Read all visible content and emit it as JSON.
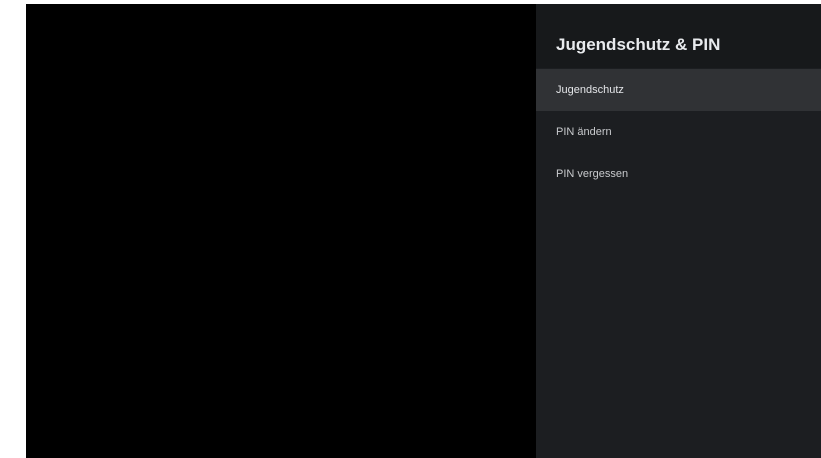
{
  "panel": {
    "title": "Jugendschutz & PIN",
    "items": [
      {
        "label": "Jugendschutz",
        "selected": true
      },
      {
        "label": "PIN ändern",
        "selected": false
      },
      {
        "label": "PIN vergessen",
        "selected": false
      }
    ]
  },
  "colors": {
    "background": "#000000",
    "panel": "#1c1e21",
    "panel_header": "#17191b",
    "selected_item": "#303235",
    "text": "#e8eaed"
  }
}
